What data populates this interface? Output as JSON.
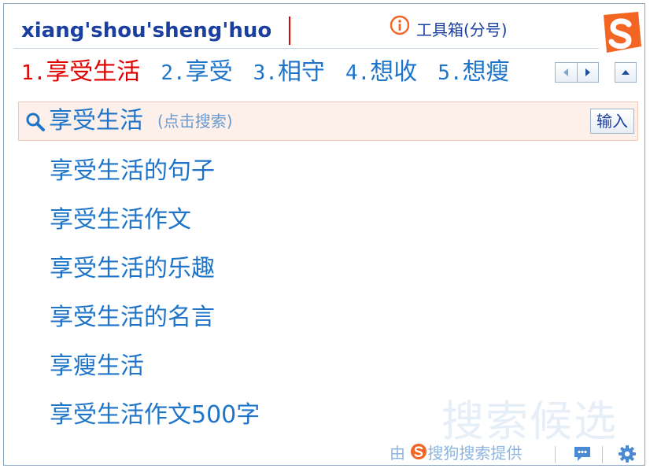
{
  "input": {
    "pinyin": "xiang'shou'sheng'huo"
  },
  "toolbox": {
    "label": "工具箱(分号)",
    "icon": "info-icon"
  },
  "brand": {
    "logo_icon": "sogou-logo-icon",
    "accent": "#f26522"
  },
  "candidates": [
    {
      "num": "1.",
      "text": "享受生活",
      "selected": true
    },
    {
      "num": "2.",
      "text": "享受",
      "selected": false
    },
    {
      "num": "3.",
      "text": "相守",
      "selected": false
    },
    {
      "num": "4.",
      "text": "想收",
      "selected": false
    },
    {
      "num": "5.",
      "text": "想瘦",
      "selected": false
    }
  ],
  "search": {
    "query": "享受生活",
    "hint": "(点击搜索)",
    "input_button": "输入"
  },
  "suggestions": [
    "享受生活的句子",
    "享受生活作文",
    "享受生活的乐趣",
    "享受生活的名言",
    "享瘦生活",
    "享受生活作文500字"
  ],
  "watermark": "搜索候选",
  "footer": {
    "provider_prefix": "由",
    "provider_text": "搜狗搜索提供"
  },
  "colors": {
    "selected": "#e00000",
    "candidate": "#1e74c8",
    "pinyin": "#1a3fa0",
    "search_bg": "#fdf0ea"
  }
}
